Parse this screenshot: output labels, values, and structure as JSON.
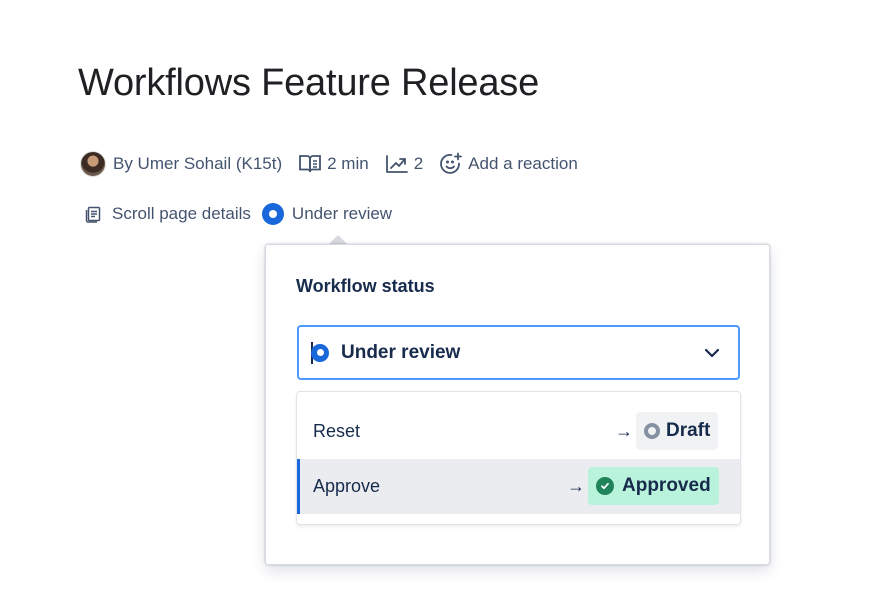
{
  "page": {
    "title": "Workflows Feature Release"
  },
  "byline": {
    "author": "By Umer Sohail (K15t)",
    "read_time": "2 min",
    "views": "2",
    "reaction": "Add a reaction"
  },
  "details": {
    "scroll_link": "Scroll page details",
    "status": "Under review"
  },
  "popover": {
    "title": "Workflow status",
    "selected_status": "Under review",
    "transitions": [
      {
        "action": "Reset",
        "arrow": "→",
        "target": "Draft"
      },
      {
        "action": "Approve",
        "arrow": "→",
        "target": "Approved"
      }
    ]
  },
  "colors": {
    "accent": "#1868DB",
    "focus_border": "#4C9AFF",
    "approved_bg": "#BAF3DB",
    "approved_icon": "#1F845A",
    "draft_bg": "#F1F2F4"
  },
  "icons": {
    "avatar": "user-avatar",
    "read_time": "book-open-icon",
    "views": "trend-up-icon",
    "reaction": "emoji-add-icon",
    "scroll_details": "page-details-icon",
    "status": "status-dot-icon",
    "dropdown": "chevron-down-icon",
    "approved": "check-circle-icon",
    "draft": "status-ring-icon"
  }
}
